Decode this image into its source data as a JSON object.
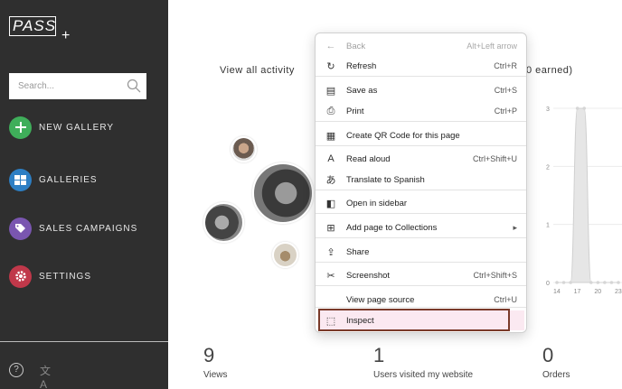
{
  "sidebar": {
    "logo_text": "PASS",
    "logo_plus": "+",
    "search_placeholder": "Search...",
    "items": [
      {
        "label": "NEW GALLERY",
        "color": "#3fae5a"
      },
      {
        "label": "GALLERIES",
        "color": "#2d7fc4"
      },
      {
        "label": "SALES CAMPAIGNS",
        "color": "#7a56b0"
      },
      {
        "label": "SETTINGS",
        "color": "#c0384a"
      }
    ],
    "help_glyph": "?",
    "translate_glyph": "文A"
  },
  "main": {
    "view_all_activity": "View all activity",
    "earned_partial": "0 earned)",
    "stats": [
      {
        "value": "9",
        "label": "Views"
      },
      {
        "value": "1",
        "label": "Users visited my website"
      },
      {
        "value": "0",
        "label": "Orders"
      }
    ]
  },
  "chart_data": {
    "type": "area",
    "y_ticks": [
      "3",
      "2",
      "1",
      "0"
    ],
    "x_ticks": [
      "14",
      "17",
      "20",
      "23"
    ],
    "ylim": [
      0,
      3
    ],
    "x": [
      14,
      15,
      16,
      17,
      18,
      19,
      20,
      21,
      22,
      23
    ],
    "values": [
      0,
      0,
      0,
      3,
      3,
      0,
      0,
      0,
      0,
      0
    ]
  },
  "context_menu": {
    "items": [
      {
        "label": "Back",
        "shortcut": "Alt+Left arrow",
        "icon": "back-arrow-icon",
        "glyph": "←",
        "disabled": true
      },
      {
        "label": "Refresh",
        "shortcut": "Ctrl+R",
        "icon": "refresh-icon",
        "glyph": "↻"
      },
      {
        "label": "Save as",
        "shortcut": "Ctrl+S",
        "icon": "save-icon",
        "glyph": "▤"
      },
      {
        "label": "Print",
        "shortcut": "Ctrl+P",
        "icon": "print-icon",
        "glyph": "⎙"
      },
      {
        "label": "Create QR Code for this page",
        "shortcut": "",
        "icon": "qr-code-icon",
        "glyph": "▦"
      },
      {
        "label": "Read aloud",
        "shortcut": "Ctrl+Shift+U",
        "icon": "read-aloud-icon",
        "glyph": "A"
      },
      {
        "label": "Translate to Spanish",
        "shortcut": "",
        "icon": "translate-icon",
        "glyph": "あ"
      },
      {
        "label": "Open in sidebar",
        "shortcut": "",
        "icon": "sidebar-icon",
        "glyph": "◧"
      },
      {
        "label": "Add page to Collections",
        "shortcut": "",
        "icon": "collections-icon",
        "glyph": "⊞",
        "submenu": "▸"
      },
      {
        "label": "Share",
        "shortcut": "",
        "icon": "share-icon",
        "glyph": "⇪"
      },
      {
        "label": "Screenshot",
        "shortcut": "Ctrl+Shift+S",
        "icon": "screenshot-icon",
        "glyph": "✂"
      },
      {
        "label": "View page source",
        "shortcut": "Ctrl+U",
        "icon": "",
        "glyph": ""
      },
      {
        "label": "Inspect",
        "shortcut": "",
        "icon": "inspect-icon",
        "glyph": "⬚"
      }
    ]
  }
}
